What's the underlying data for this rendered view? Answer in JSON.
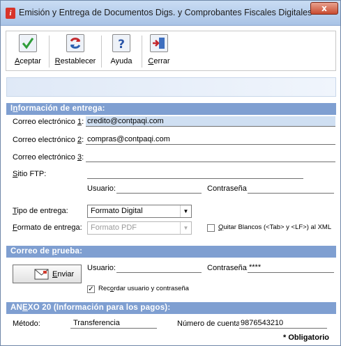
{
  "window": {
    "title": "Emisión y Entrega de Documentos Digs. y Comprobantes Fiscales Digitales",
    "close_glyph": "x"
  },
  "toolbar": {
    "aceptar": {
      "pre": "",
      "ul": "A",
      "post": "ceptar",
      "icon": "checkmark-icon"
    },
    "restablecer": {
      "pre": "",
      "ul": "R",
      "post": "establecer",
      "icon": "refresh-icon"
    },
    "ayuda": {
      "pre": "",
      "ul": "",
      "post": "Ayuda",
      "icon": "help-icon"
    },
    "cerrar": {
      "pre": "",
      "ul": "C",
      "post": "errar",
      "icon": "exit-door-icon"
    }
  },
  "delivery": {
    "title_pre": "I",
    "title_ul": "n",
    "title_post": "formación de entrega:",
    "email1": {
      "label_pre": "Correo electrónico ",
      "label_ul": "1",
      "label_post": ":",
      "value": "credito@contpaqi.com"
    },
    "email2": {
      "label_pre": "Correo electrónico ",
      "label_ul": "2",
      "label_post": ":",
      "value": "compras@contpaqi.com"
    },
    "email3": {
      "label_pre": "Correo electrónico ",
      "label_ul": "3",
      "label_post": ":",
      "value": ""
    },
    "ftp": {
      "label_ul": "S",
      "label_post": "itio FTP:",
      "value": "",
      "user_label": "Usuario:",
      "user_value": "",
      "pass_label": "Contraseña:",
      "pass_value": ""
    },
    "tipo": {
      "label_ul": "T",
      "label_post": "ipo de entrega:",
      "value": "Formato Digital"
    },
    "formato": {
      "label_ul": "F",
      "label_post": "ormato de entrega:",
      "value": "Formato PDF"
    },
    "quitar": {
      "label_ul": "Q",
      "label_post": "uitar Blancos (<Tab> y <LF>) al  XML",
      "checked": false
    }
  },
  "test": {
    "title_pre": "Correo de ",
    "title_ul": "p",
    "title_post": "rueba:",
    "send_label_ul": "E",
    "send_label_post": "nviar",
    "send_icon": "envelope-send-icon",
    "user_label": "Usuario:",
    "user_value": "",
    "pass_label": "Contraseña:",
    "pass_value": "****",
    "remember_pre": "Rec",
    "remember_ul": "o",
    "remember_post": "rdar usuario y contraseña",
    "remember_checked": true
  },
  "annex": {
    "title_pre": "AN",
    "title_ul": "E",
    "title_post": "XO 20 (Información para los pagos):",
    "method_label": "Método:",
    "method_value": "Transferencia",
    "account_label": "Número de cuenta:",
    "account_value": "9876543210"
  },
  "required_note": "* Obligatorio"
}
